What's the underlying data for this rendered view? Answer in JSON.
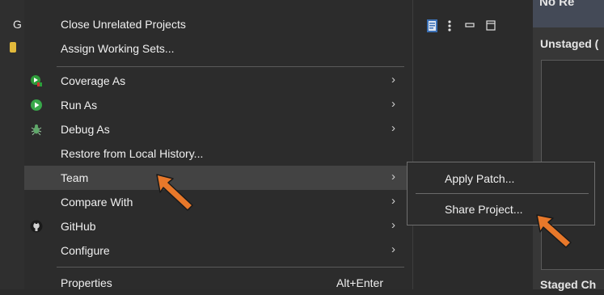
{
  "tree": {
    "partial_label": "G"
  },
  "menu": {
    "items": [
      {
        "label": "Close Unrelated Projects",
        "has_submenu": false,
        "icon": ""
      },
      {
        "label": "Assign Working Sets...",
        "has_submenu": false,
        "icon": ""
      },
      {
        "label": "Coverage As",
        "has_submenu": true,
        "icon": "coverage-icon"
      },
      {
        "label": "Run As",
        "has_submenu": true,
        "icon": "run-icon"
      },
      {
        "label": "Debug As",
        "has_submenu": true,
        "icon": "debug-bug-icon"
      },
      {
        "label": "Restore from Local History...",
        "has_submenu": false,
        "icon": ""
      },
      {
        "label": "Team",
        "has_submenu": true,
        "icon": "",
        "highlighted": true
      },
      {
        "label": "Compare With",
        "has_submenu": true,
        "icon": ""
      },
      {
        "label": "GitHub",
        "has_submenu": true,
        "icon": "github-icon"
      },
      {
        "label": "Configure",
        "has_submenu": true,
        "icon": ""
      },
      {
        "label": "Properties",
        "accelerator": "Alt+Enter",
        "has_submenu": false,
        "icon": ""
      }
    ],
    "arrow_glyph": "›"
  },
  "team_submenu": {
    "items": [
      {
        "label": "Apply Patch..."
      },
      {
        "label": "Share Project..."
      }
    ]
  },
  "right_panel": {
    "top_title": "No Re",
    "unstaged_label": "Unstaged (",
    "staged_label": "Staged Ch"
  },
  "colors": {
    "menu_bg": "#2c2c2c",
    "hover_bg": "#434343",
    "annotation_arrow": "#e8782a"
  }
}
